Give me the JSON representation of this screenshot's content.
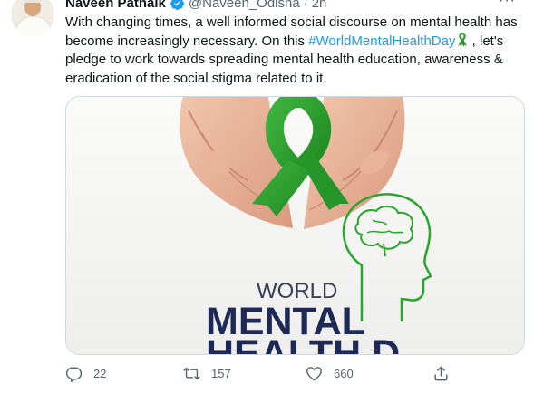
{
  "tweet": {
    "author_name": "Naveen Patnaik",
    "handle": "@Naveen_Odisha",
    "separator": "·",
    "time": "2h",
    "more_label": "···",
    "text_part1": "With changing times, a well informed social discourse on mental health has become increasingly necessary. On this ",
    "hashtag": "#WorldMentalHealthDay",
    "text_part2": " , let's pledge to work towards spreading mental health education, awareness & eradication of the social stigma related to it.",
    "image": {
      "line1": "WORLD",
      "line2": "MENTAL",
      "line3": "HEALTH D"
    }
  },
  "actions": {
    "replies": "22",
    "retweets": "157",
    "likes": "660"
  },
  "colors": {
    "accent": "#1d9bf0",
    "ribbon": "#2e9f2e",
    "title_dark": "#1e2a55"
  }
}
